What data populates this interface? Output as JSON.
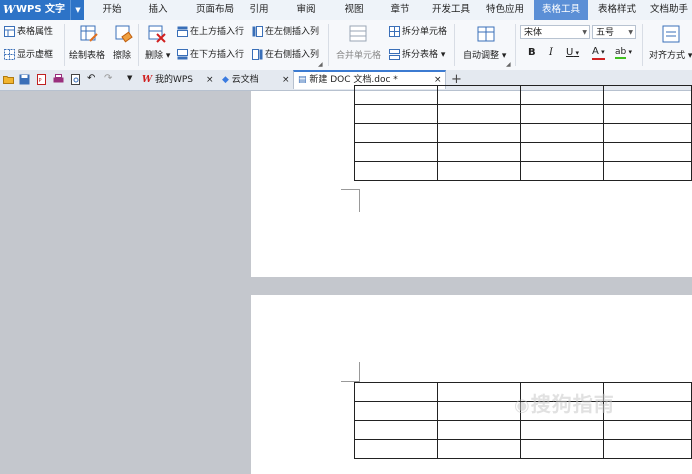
{
  "app": {
    "brand": "WPS 文字"
  },
  "menu": {
    "tabs": [
      "开始",
      "插入",
      "页面布局",
      "引用",
      "审阅",
      "视图",
      "章节",
      "开发工具",
      "特色应用",
      "表格工具",
      "表格样式",
      "文档助手"
    ]
  },
  "ribbon": {
    "table_props": "表格属性",
    "show_gridlines": "显示虚框",
    "draw_table": "绘制表格",
    "erase": "擦除",
    "delete": "删除",
    "insert_above": "在上方插入行",
    "insert_below": "在下方插入行",
    "insert_left": "在左侧插入列",
    "insert_right": "在右侧插入列",
    "merge_cells": "合并单元格",
    "split_cells": "拆分单元格",
    "split_table": "拆分表格",
    "auto_fit": "自动调整",
    "font_name": "宋体",
    "font_size": "五号",
    "bold": "B",
    "italic": "I",
    "underline": "U",
    "font_color": "A",
    "align": "对齐方式"
  },
  "tabs": [
    {
      "label": "我的WPS"
    },
    {
      "label": "云文档"
    },
    {
      "label": "新建 DOC 文档.doc *"
    }
  ],
  "watermark": "搜狗指南",
  "colors": {
    "brand": "#2d73c7",
    "active_tab": "#5b8fd6",
    "canvas": "#c4c7cd"
  }
}
